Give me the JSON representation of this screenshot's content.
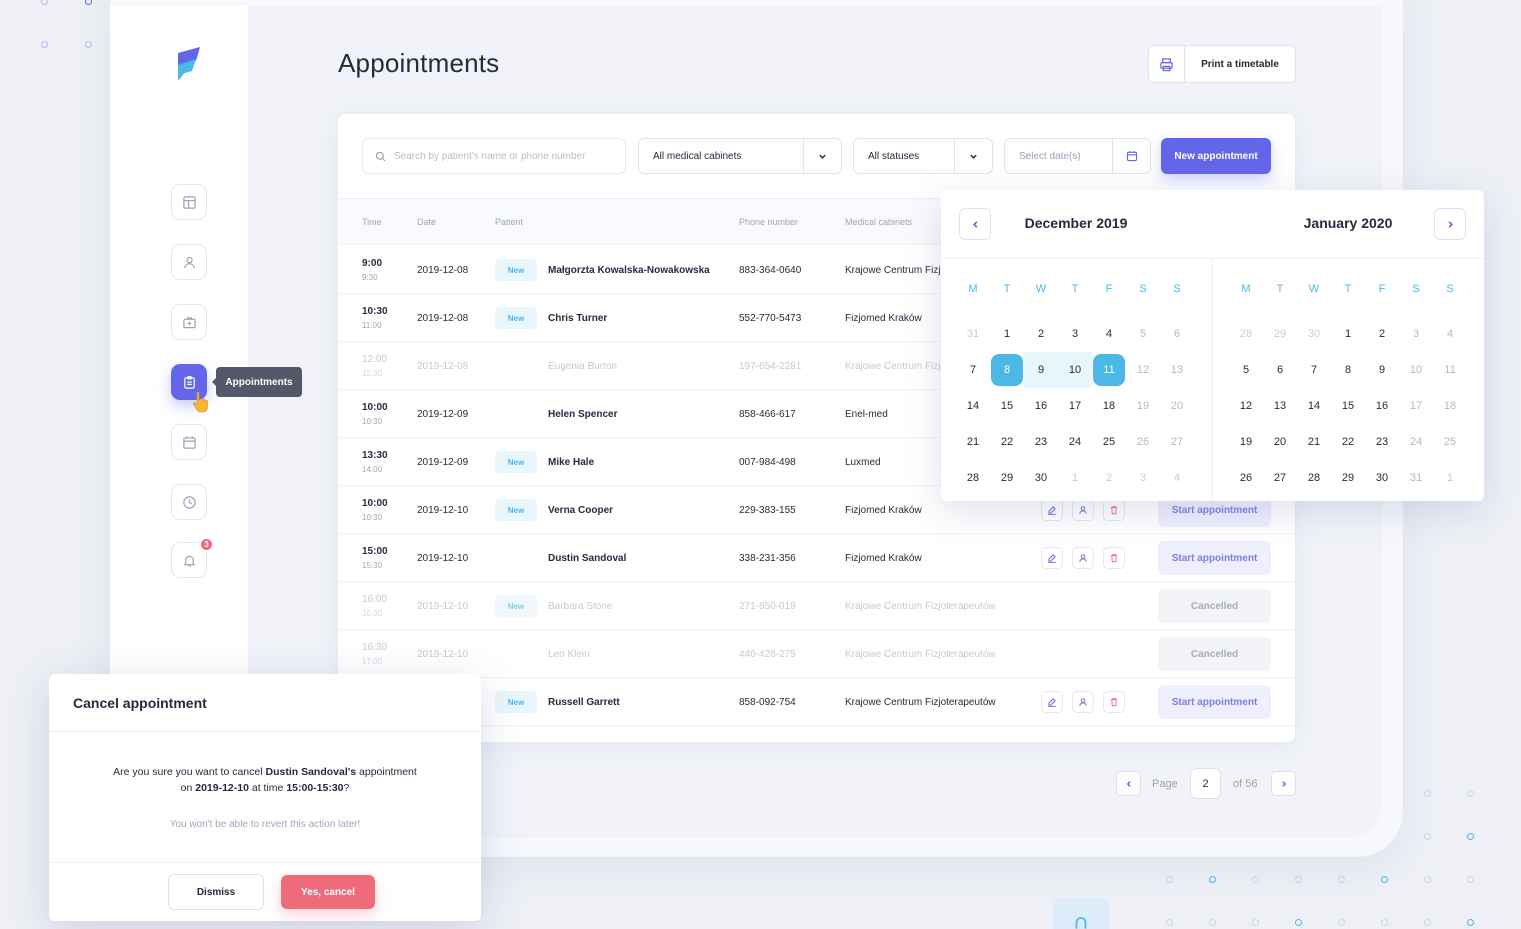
{
  "page": {
    "title": "Appointments",
    "print_label": "Print a timetable"
  },
  "sidebar": {
    "tooltip": "Appointments",
    "notification_count": "3",
    "items": [
      "layout-icon",
      "user-icon",
      "briefcase-medical-icon",
      "clipboard-icon",
      "calendar-icon",
      "clock-icon",
      "bell-icon"
    ]
  },
  "filters": {
    "search_placeholder": "Search by patient's name or phone number",
    "cabinet": "All medical cabinets",
    "status": "All statuses",
    "date_placeholder": "Select date(s)",
    "new_label": "New appointment"
  },
  "table": {
    "headers": [
      "Time",
      "Date",
      "Patient",
      "Phone number",
      "Medical cabinets"
    ],
    "rows": [
      {
        "start": "9:00",
        "end": "9:30",
        "date": "2019-12-08",
        "tag": "New",
        "patient": "Małgorzta Kowalska-Nowakowska",
        "phone": "883-364-0640",
        "cabinet": "Krajowe Centrum Fizjoterapeutów",
        "dim": false,
        "status": ""
      },
      {
        "start": "10:30",
        "end": "11:00",
        "date": "2019-12-08",
        "tag": "New",
        "patient": "Chris Turner",
        "phone": "552-770-5473",
        "cabinet": "Fizjomed Kraków",
        "dim": false,
        "status": ""
      },
      {
        "start": "12:00",
        "end": "12:30",
        "date": "2019-12-08",
        "tag": "",
        "patient": "Eugenia Burton",
        "phone": "197-654-2281",
        "cabinet": "Krajowe Centrum Fizjoterapeutów",
        "dim": true,
        "status": ""
      },
      {
        "start": "10:00",
        "end": "10:30",
        "date": "2019-12-09",
        "tag": "",
        "patient": "Helen Spencer",
        "phone": "858-466-617",
        "cabinet": "Enel-med",
        "dim": false,
        "status": ""
      },
      {
        "start": "13:30",
        "end": "14:00",
        "date": "2019-12-09",
        "tag": "New",
        "patient": "Mike Hale",
        "phone": "007-984-498",
        "cabinet": "Luxmed",
        "dim": false,
        "status": ""
      },
      {
        "start": "10:00",
        "end": "10:30",
        "date": "2019-12-10",
        "tag": "New",
        "patient": "Verna Cooper",
        "phone": "229-383-155",
        "cabinet": "Fizjomed Kraków",
        "dim": false,
        "status": "Start appointment"
      },
      {
        "start": "15:00",
        "end": "15:30",
        "date": "2019-12-10",
        "tag": "",
        "patient": "Dustin Sandoval",
        "phone": "338-231-356",
        "cabinet": "Fizjomed Kraków",
        "dim": false,
        "status": "Start appointment"
      },
      {
        "start": "16:00",
        "end": "16:30",
        "date": "2019-12-10",
        "tag": "New",
        "patient": "Barbara Stone",
        "phone": "271-850-018",
        "cabinet": "Krajowe Centrum Fizjoterapeutów",
        "dim": true,
        "status": "Cancelled"
      },
      {
        "start": "16:30",
        "end": "17:00",
        "date": "2019-12-10",
        "tag": "",
        "patient": "Leo Klein",
        "phone": "446-428-275",
        "cabinet": "Krajowe Centrum Fizjoterapeutów",
        "dim": true,
        "status": "Cancelled"
      },
      {
        "start": "",
        "end": "",
        "date": "",
        "tag": "New",
        "patient": "Russell Garrett",
        "phone": "858-092-754",
        "cabinet": "Krajowe Centrum Fizjoterapeutów",
        "dim": false,
        "status": "Start appointment"
      }
    ]
  },
  "pagination": {
    "page_label": "Page",
    "current": "2",
    "total_label": "of 56"
  },
  "calendar": {
    "left_month": "December 2019",
    "right_month": "January 2020",
    "weekdays": [
      "M",
      "T",
      "W",
      "T",
      "F",
      "S",
      "S"
    ],
    "left_days": [
      "31",
      "1",
      "2",
      "3",
      "4",
      "5",
      "6",
      "7",
      "8",
      "9",
      "10",
      "11",
      "12",
      "13",
      "14",
      "15",
      "16",
      "17",
      "18",
      "19",
      "20",
      "21",
      "22",
      "23",
      "24",
      "25",
      "26",
      "27",
      "28",
      "29",
      "30",
      "1",
      "2",
      "3",
      "4"
    ],
    "right_days": [
      "28",
      "29",
      "30",
      "1",
      "2",
      "3",
      "4",
      "5",
      "6",
      "7",
      "8",
      "9",
      "10",
      "11",
      "12",
      "13",
      "14",
      "15",
      "16",
      "17",
      "18",
      "19",
      "20",
      "21",
      "22",
      "23",
      "24",
      "25",
      "26",
      "27",
      "28",
      "29",
      "30",
      "31",
      "1"
    ],
    "selected_start": "8",
    "selected_end": "11"
  },
  "modal": {
    "title": "Cancel appointment",
    "msg_prefix": "Are you sure you want to cancel ",
    "msg_name": "Dustin Sandoval's",
    "msg_mid": " appointment",
    "msg_on": "on ",
    "msg_date": "2019-12-10",
    "msg_at": " at time ",
    "msg_time": "15:00-15:30",
    "msg_end": "?",
    "warning": "You won't be able to revert this action later!",
    "dismiss_label": "Dismiss",
    "confirm_label": "Yes, cancel"
  },
  "colors": {
    "accent": "#6466e9",
    "calendar_accent": "#4bb8e8",
    "danger": "#ef6b7b"
  }
}
